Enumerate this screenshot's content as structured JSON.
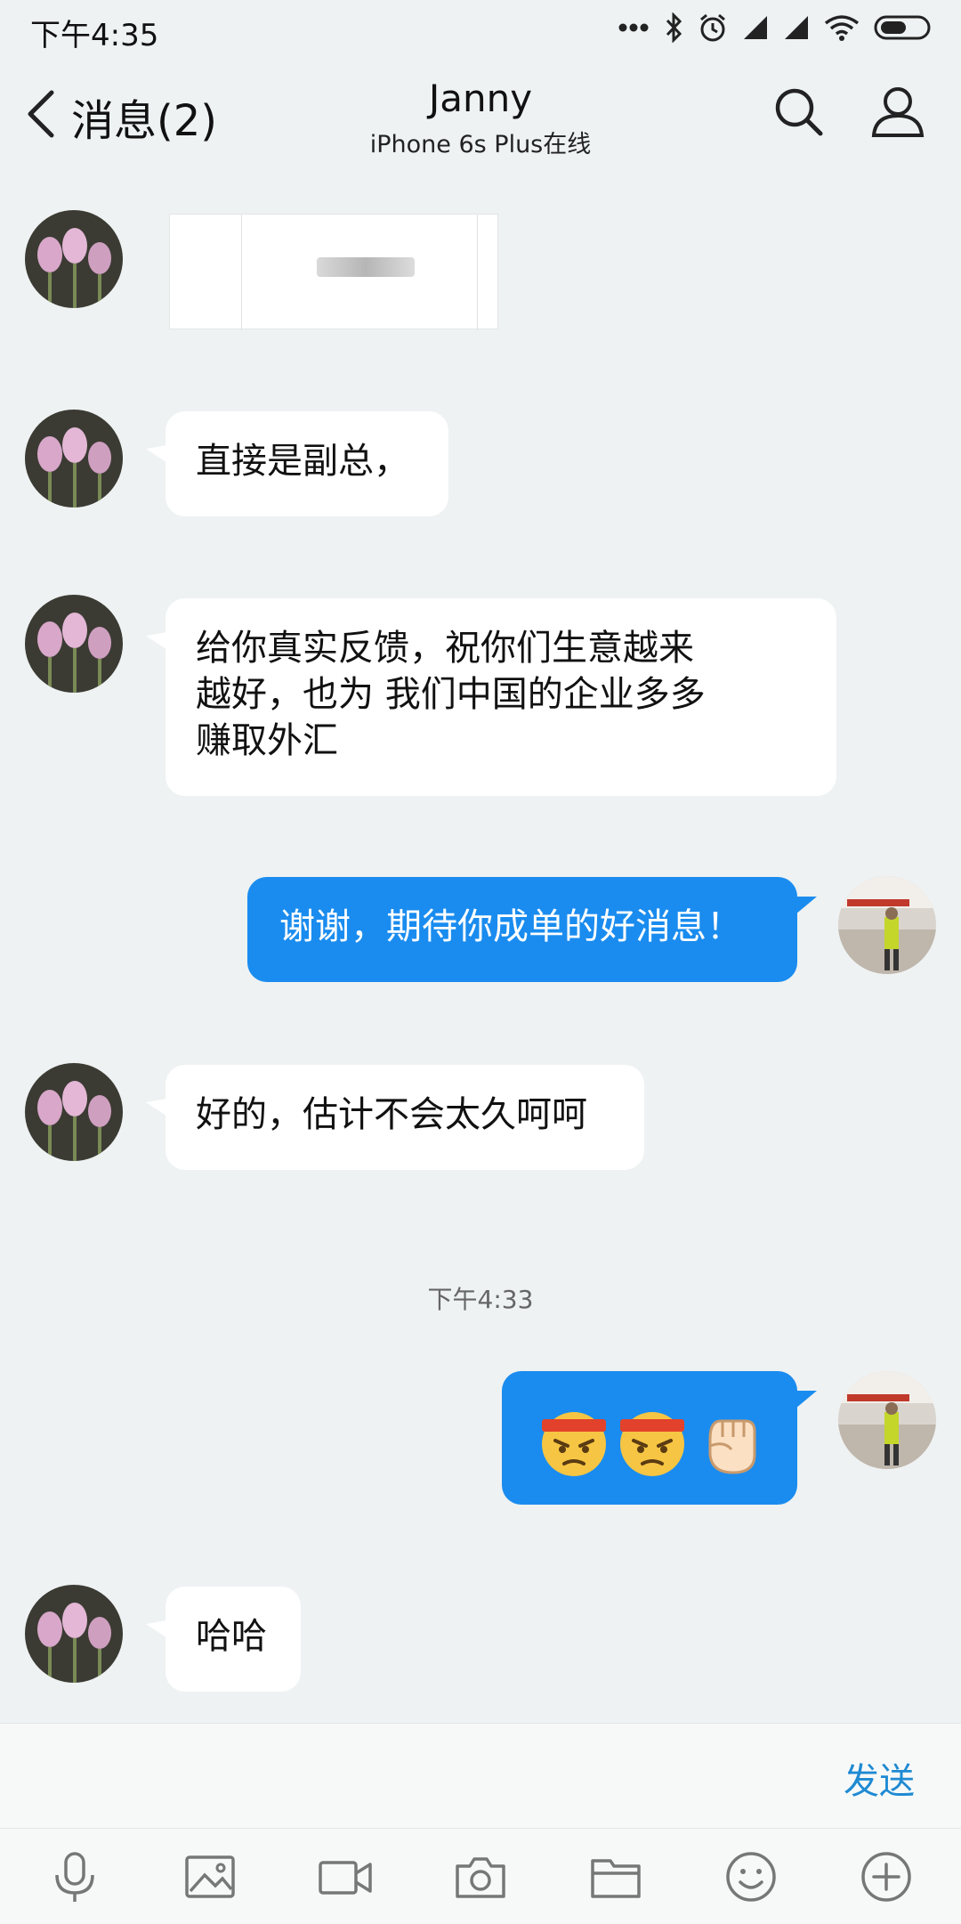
{
  "status_bar": {
    "time": "下午4:35"
  },
  "header": {
    "back_label": "消息(2)",
    "contact_name": "Janny",
    "contact_status": "iPhone 6s Plus在线"
  },
  "messages": [
    {
      "side": "incoming",
      "type": "image",
      "text": ""
    },
    {
      "side": "incoming",
      "type": "text",
      "text": "直接是副总，"
    },
    {
      "side": "incoming",
      "type": "text",
      "text": "给你真实反馈，祝你们生意越来越好，也为 我们中国的企业多多赚取外汇"
    },
    {
      "side": "outgoing",
      "type": "text",
      "text": "谢谢，期待你成单的好消息！"
    },
    {
      "side": "incoming",
      "type": "text",
      "text": "好的，估计不会太久呵呵"
    },
    {
      "side": "outgoing",
      "type": "emoji",
      "icons": [
        "determined-face-emoji",
        "determined-face-emoji",
        "raised-fist-emoji"
      ]
    },
    {
      "side": "incoming",
      "type": "text",
      "text": "哈哈"
    }
  ],
  "timestamp": "下午4:33",
  "input": {
    "send_label": "发送"
  },
  "toolbar": [
    "microphone-icon",
    "image-icon",
    "video-icon",
    "camera-icon",
    "folder-icon",
    "smiley-icon",
    "plus-icon"
  ],
  "colors": {
    "background": "#eef2f2",
    "outgoing_bubble": "#1a8cef",
    "incoming_bubble": "#ffffff",
    "send": "#1f8ad2"
  }
}
